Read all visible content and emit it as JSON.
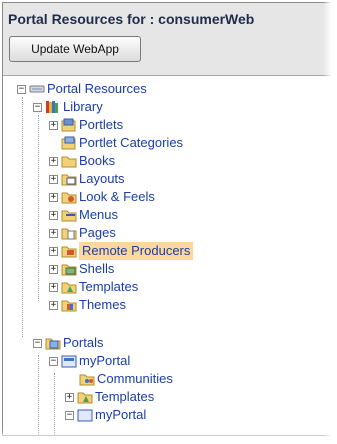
{
  "panel": {
    "title": "Portal Resources for : consumerWeb",
    "button_label": "Update WebApp"
  },
  "tree": {
    "root": "Portal Resources",
    "library": "Library",
    "library_items": [
      "Portlets",
      "Portlet Categories",
      "Books",
      "Layouts",
      "Look & Feels",
      "Menus",
      "Pages",
      "Remote Producers",
      "Shells",
      "Templates",
      "Themes"
    ],
    "selected_item": "Remote Producers",
    "portals": "Portals",
    "portal": "myPortal",
    "portal_items": [
      "Communities",
      "Templates",
      "myPortal"
    ]
  },
  "colors": {
    "link_text": "#1a3ea8",
    "selection": "#fdd89a",
    "header_bg": "#e6e6e6"
  }
}
